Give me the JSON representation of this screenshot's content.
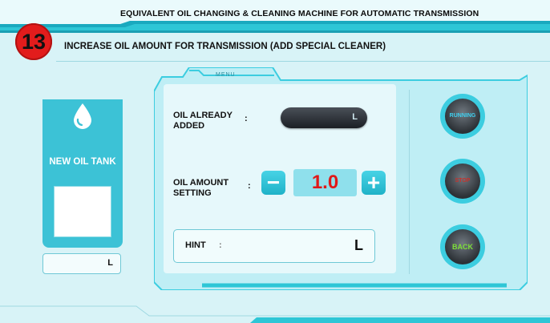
{
  "header": {
    "title": "EQUIVALENT OIL CHANGING & CLEANING MACHINE FOR  AUTOMATIC TRANSMISSION",
    "step_number": "13",
    "subtitle": "INCREASE OIL AMOUNT FOR TRANSMISSION (ADD SPECIAL CLEANER)"
  },
  "tank": {
    "label": "NEW OIL TANK",
    "unit": "L",
    "icon": "oil-drop-icon"
  },
  "menu": {
    "label": "MENU",
    "oil_added_label_1": "OIL ALREADY",
    "oil_added_colon": ":",
    "oil_added_label_2": "ADDED",
    "oil_added_unit": "L",
    "amount_label_1": "OIL AMOUNT",
    "amount_colon": ":",
    "amount_label_2": "SETTING",
    "amount_value": "1.0",
    "minus_label": "−",
    "plus_label": "+",
    "hint_label": "HINT",
    "hint_colon": ":",
    "hint_unit": "L"
  },
  "buttons": {
    "running": "RUNNING",
    "stop": "STOP",
    "back": "BACK"
  },
  "colors": {
    "accent": "#2ec6d6",
    "background": "#d8f3f7",
    "badge": "#e21c1c",
    "value": "#e01818",
    "running_text": "#3fd0f0",
    "stop_text": "#c8322c",
    "back_text": "#7ee03a"
  }
}
